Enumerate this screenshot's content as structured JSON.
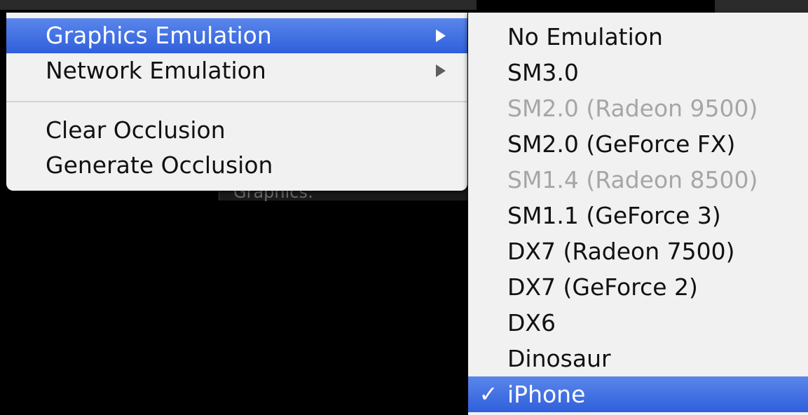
{
  "background_label": "Graphics:",
  "menu": {
    "items": [
      {
        "label": "Graphics Emulation",
        "has_submenu": true,
        "highlighted": true
      },
      {
        "label": "Network Emulation",
        "has_submenu": true,
        "highlighted": false
      }
    ],
    "actions": [
      {
        "label": "Clear Occlusion"
      },
      {
        "label": "Generate Occlusion"
      }
    ]
  },
  "submenu": {
    "items": [
      {
        "label": "No Emulation",
        "enabled": true
      },
      {
        "label": "SM3.0",
        "enabled": true
      },
      {
        "label": "SM2.0 (Radeon 9500)",
        "enabled": false
      },
      {
        "label": "SM2.0 (GeForce FX)",
        "enabled": true
      },
      {
        "label": "SM1.4 (Radeon 8500)",
        "enabled": false
      },
      {
        "label": "SM1.1 (GeForce 3)",
        "enabled": true
      },
      {
        "label": "DX7 (Radeon 7500)",
        "enabled": true
      },
      {
        "label": "DX7 (GeForce 2)",
        "enabled": true
      },
      {
        "label": "DX6",
        "enabled": true
      },
      {
        "label": "Dinosaur",
        "enabled": true
      },
      {
        "label": "iPhone",
        "enabled": true,
        "checked": true
      }
    ],
    "check_glyph": "✓"
  },
  "icons": {
    "submenu_arrow": "triangle-right-icon",
    "checkmark": "checkmark-icon"
  },
  "colors": {
    "highlight": "#3a6ce0",
    "menu_background": "#f1f1f1",
    "disabled_text": "#a6a6a6"
  }
}
